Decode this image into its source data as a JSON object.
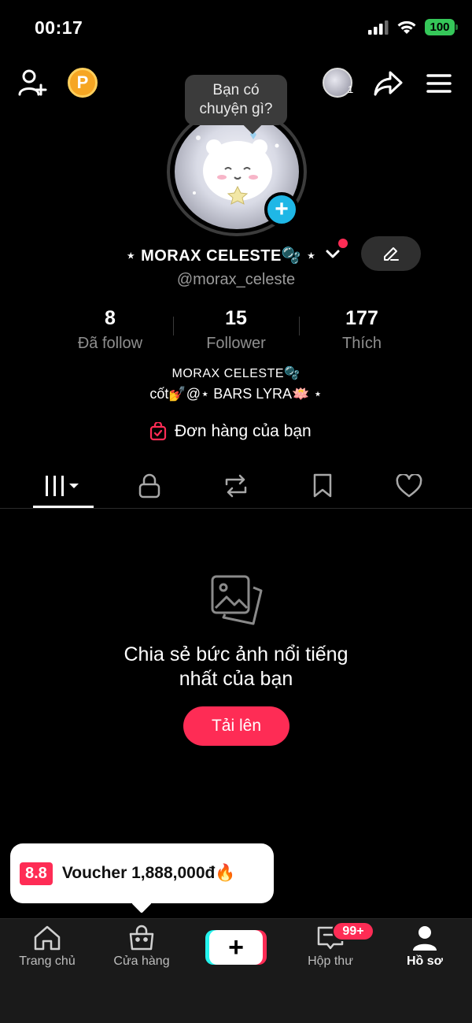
{
  "status_bar": {
    "time": "00:17",
    "battery": "100"
  },
  "header": {
    "coin_label": "P",
    "mini_avatar_count": "1"
  },
  "bubble": {
    "line1": "Bạn có",
    "line2": "chuyện gì?"
  },
  "profile": {
    "name": "⋆ MORAX CELESTE🫧 ⋆",
    "handle": "@morax_celeste",
    "stats": [
      {
        "value": "8",
        "label": "Đã follow"
      },
      {
        "value": "15",
        "label": "Follower"
      },
      {
        "value": "177",
        "label": "Thích"
      }
    ],
    "bio_line1": "MORAX CELESTE🫧",
    "bio_line2": "cốt💅@⋆ BARS LYRA🪷 ⋆",
    "orders_label": "Đơn hàng của bạn"
  },
  "tabs": [
    "posts-grid-icon",
    "lock-icon",
    "repost-icon",
    "bookmark-icon",
    "heart-icon"
  ],
  "empty_state": {
    "title_line1": "Chia sẻ bức ảnh nổi tiếng",
    "title_line2": "nhất của bạn",
    "button": "Tải lên"
  },
  "voucher": {
    "badge": "8.8",
    "text": "Voucher 1,888,000đ🔥"
  },
  "bottom_nav": {
    "home": "Trang chủ",
    "shop": "Cửa hàng",
    "inbox": "Hộp thư",
    "inbox_badge": "99+",
    "profile": "Hồ sơ"
  },
  "colors": {
    "accent": "#fe2c55",
    "cyan": "#25f4ee",
    "avatar_add": "#1fb7e6",
    "coin": "#f6a623",
    "battery": "#35c759"
  }
}
